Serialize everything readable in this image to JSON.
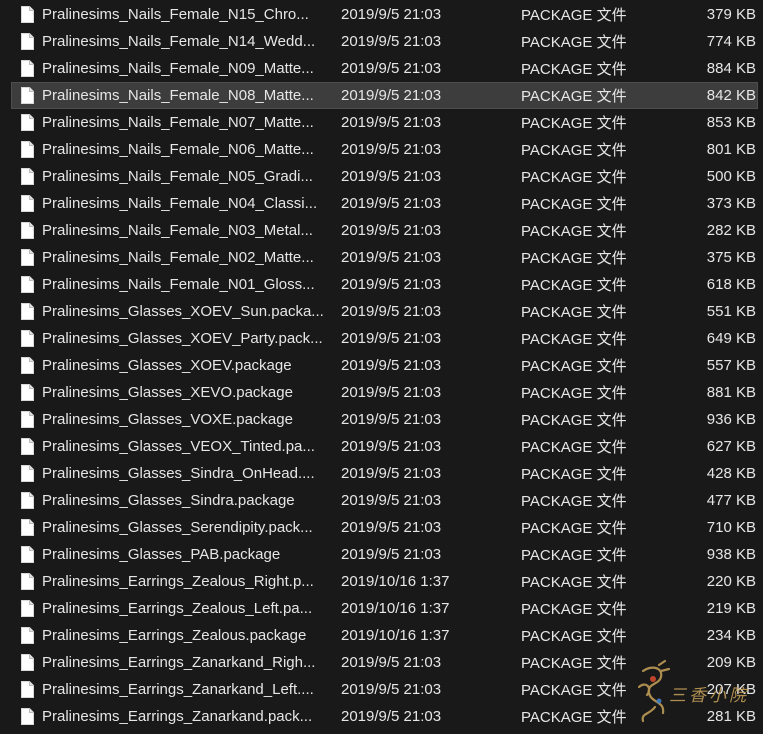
{
  "files": [
    {
      "name": "Pralinesims_Nails_Female_N15_Chro...",
      "date": "2019/9/5 21:03",
      "type": "PACKAGE 文件",
      "size": "379 KB"
    },
    {
      "name": "Pralinesims_Nails_Female_N14_Wedd...",
      "date": "2019/9/5 21:03",
      "type": "PACKAGE 文件",
      "size": "774 KB"
    },
    {
      "name": "Pralinesims_Nails_Female_N09_Matte...",
      "date": "2019/9/5 21:03",
      "type": "PACKAGE 文件",
      "size": "884 KB"
    },
    {
      "name": "Pralinesims_Nails_Female_N08_Matte...",
      "date": "2019/9/5 21:03",
      "type": "PACKAGE 文件",
      "size": "842 KB",
      "selected": true
    },
    {
      "name": "Pralinesims_Nails_Female_N07_Matte...",
      "date": "2019/9/5 21:03",
      "type": "PACKAGE 文件",
      "size": "853 KB"
    },
    {
      "name": "Pralinesims_Nails_Female_N06_Matte...",
      "date": "2019/9/5 21:03",
      "type": "PACKAGE 文件",
      "size": "801 KB"
    },
    {
      "name": "Pralinesims_Nails_Female_N05_Gradi...",
      "date": "2019/9/5 21:03",
      "type": "PACKAGE 文件",
      "size": "500 KB"
    },
    {
      "name": "Pralinesims_Nails_Female_N04_Classi...",
      "date": "2019/9/5 21:03",
      "type": "PACKAGE 文件",
      "size": "373 KB"
    },
    {
      "name": "Pralinesims_Nails_Female_N03_Metal...",
      "date": "2019/9/5 21:03",
      "type": "PACKAGE 文件",
      "size": "282 KB"
    },
    {
      "name": "Pralinesims_Nails_Female_N02_Matte...",
      "date": "2019/9/5 21:03",
      "type": "PACKAGE 文件",
      "size": "375 KB"
    },
    {
      "name": "Pralinesims_Nails_Female_N01_Gloss...",
      "date": "2019/9/5 21:03",
      "type": "PACKAGE 文件",
      "size": "618 KB"
    },
    {
      "name": "Pralinesims_Glasses_XOEV_Sun.packa...",
      "date": "2019/9/5 21:03",
      "type": "PACKAGE 文件",
      "size": "551 KB"
    },
    {
      "name": "Pralinesims_Glasses_XOEV_Party.pack...",
      "date": "2019/9/5 21:03",
      "type": "PACKAGE 文件",
      "size": "649 KB"
    },
    {
      "name": "Pralinesims_Glasses_XOEV.package",
      "date": "2019/9/5 21:03",
      "type": "PACKAGE 文件",
      "size": "557 KB"
    },
    {
      "name": "Pralinesims_Glasses_XEVO.package",
      "date": "2019/9/5 21:03",
      "type": "PACKAGE 文件",
      "size": "881 KB"
    },
    {
      "name": "Pralinesims_Glasses_VOXE.package",
      "date": "2019/9/5 21:03",
      "type": "PACKAGE 文件",
      "size": "936 KB"
    },
    {
      "name": "Pralinesims_Glasses_VEOX_Tinted.pa...",
      "date": "2019/9/5 21:03",
      "type": "PACKAGE 文件",
      "size": "627 KB"
    },
    {
      "name": "Pralinesims_Glasses_Sindra_OnHead....",
      "date": "2019/9/5 21:03",
      "type": "PACKAGE 文件",
      "size": "428 KB"
    },
    {
      "name": "Pralinesims_Glasses_Sindra.package",
      "date": "2019/9/5 21:03",
      "type": "PACKAGE 文件",
      "size": "477 KB"
    },
    {
      "name": "Pralinesims_Glasses_Serendipity.pack...",
      "date": "2019/9/5 21:03",
      "type": "PACKAGE 文件",
      "size": "710 KB"
    },
    {
      "name": "Pralinesims_Glasses_PAB.package",
      "date": "2019/9/5 21:03",
      "type": "PACKAGE 文件",
      "size": "938 KB"
    },
    {
      "name": "Pralinesims_Earrings_Zealous_Right.p...",
      "date": "2019/10/16 1:37",
      "type": "PACKAGE 文件",
      "size": "220 KB"
    },
    {
      "name": "Pralinesims_Earrings_Zealous_Left.pa...",
      "date": "2019/10/16 1:37",
      "type": "PACKAGE 文件",
      "size": "219 KB"
    },
    {
      "name": "Pralinesims_Earrings_Zealous.package",
      "date": "2019/10/16 1:37",
      "type": "PACKAGE 文件",
      "size": "234 KB"
    },
    {
      "name": "Pralinesims_Earrings_Zanarkand_Righ...",
      "date": "2019/9/5 21:03",
      "type": "PACKAGE 文件",
      "size": "209 KB"
    },
    {
      "name": "Pralinesims_Earrings_Zanarkand_Left....",
      "date": "2019/9/5 21:03",
      "type": "PACKAGE 文件",
      "size": "207 KB"
    },
    {
      "name": "Pralinesims_Earrings_Zanarkand.pack...",
      "date": "2019/9/5 21:03",
      "type": "PACKAGE 文件",
      "size": "281 KB"
    }
  ],
  "icons": {
    "file": "file-icon"
  },
  "colors": {
    "background": "#191919",
    "text": "#e6e6e6",
    "selected_row": "#3d3d3d",
    "watermark": "#c9a35a"
  },
  "watermark": {
    "text": "三香小院"
  }
}
